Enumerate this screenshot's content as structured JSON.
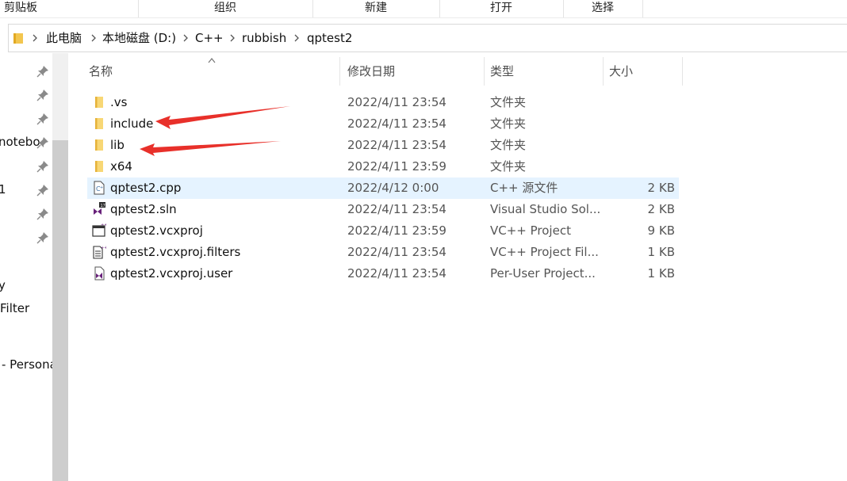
{
  "ribbon": {
    "groups": [
      "剪贴板",
      "组织",
      "新建",
      "打开",
      "选择"
    ]
  },
  "address": {
    "crumbs": [
      "此电脑",
      "本地磁盘 (D:)",
      "C++",
      "rubbish",
      "qptest2"
    ]
  },
  "nav": {
    "items": [
      "notebo",
      "1",
      "y",
      "Filter",
      "- Persona"
    ]
  },
  "columns": {
    "name": "名称",
    "date": "修改日期",
    "type": "类型",
    "size": "大小"
  },
  "files": [
    {
      "name": ".vs",
      "date": "2022/4/11 23:54",
      "type": "文件夹",
      "size": "",
      "icon": "folder-icon"
    },
    {
      "name": "include",
      "date": "2022/4/11 23:54",
      "type": "文件夹",
      "size": "",
      "icon": "folder-icon"
    },
    {
      "name": "lib",
      "date": "2022/4/11 23:54",
      "type": "文件夹",
      "size": "",
      "icon": "folder-icon"
    },
    {
      "name": "x64",
      "date": "2022/4/11 23:59",
      "type": "文件夹",
      "size": "",
      "icon": "folder-icon"
    },
    {
      "name": "qptest2.cpp",
      "date": "2022/4/12 0:00",
      "type": "C++ 源文件",
      "size": "2 KB",
      "icon": "cpp-file-icon",
      "selected": true
    },
    {
      "name": "qptest2.sln",
      "date": "2022/4/11 23:54",
      "type": "Visual Studio Sol...",
      "size": "2 KB",
      "icon": "vs-solution-icon"
    },
    {
      "name": "qptest2.vcxproj",
      "date": "2022/4/11 23:59",
      "type": "VC++ Project",
      "size": "9 KB",
      "icon": "vcxproj-icon"
    },
    {
      "name": "qptest2.vcxproj.filters",
      "date": "2022/4/11 23:54",
      "type": "VC++ Project Fil...",
      "size": "1 KB",
      "icon": "filters-file-icon"
    },
    {
      "name": "qptest2.vcxproj.user",
      "date": "2022/4/11 23:54",
      "type": "Per-User Project...",
      "size": "1 KB",
      "icon": "vs-user-file-icon"
    }
  ],
  "colors": {
    "selection": "#e5f3ff",
    "folder": "#f8d775",
    "arrow": "#e8302a",
    "vs_purple": "#68217a"
  }
}
